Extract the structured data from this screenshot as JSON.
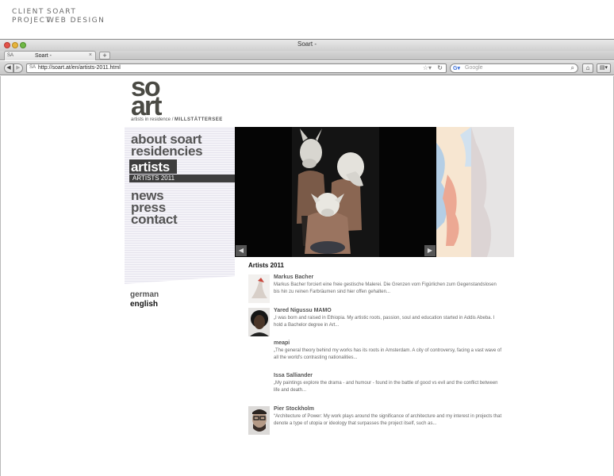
{
  "caption": {
    "client_label": "CLIENT",
    "client_value": "SOART",
    "project_label": "PROJECT",
    "project_value": "WEB DESIGN"
  },
  "browser": {
    "window_title": "Soart -",
    "tab_label": "Soart -",
    "new_tab": "+",
    "url": "http://soart.at/en/artists-2011.html",
    "search_placeholder": "Google"
  },
  "site": {
    "logo_line1": "so",
    "logo_line2": "art",
    "logo_tagline": "artists in residence /",
    "logo_location": "MILLSTÄTTERSEE",
    "nav": [
      {
        "label": "about soart"
      },
      {
        "label": "residencies"
      },
      {
        "label": "artists"
      },
      {
        "label": "news"
      },
      {
        "label": "press"
      },
      {
        "label": "contact"
      }
    ],
    "subnav_label": "ARTISTS 2011",
    "languages": [
      "german",
      "english"
    ],
    "section_title": "Artists 2011",
    "artists": [
      {
        "name": "Markus Bacher",
        "desc": "Markus Bacher forciert eine freie gestische Malerei. Die Grenzen vom Figürlichen zum Gegenstandslosen bis hin zu reinen Farbräumen sind hier offen gehalten..."
      },
      {
        "name": "Yared Nigussu MAMO",
        "desc": "„I was born and raised in Ethiopia. My artistic roots, passion, soul and education started in Addis Abeba. I hold a Bachelor degree in Art..."
      },
      {
        "name": "meapi",
        "desc": "„The general theory behind my works has its roots in Amsterdam. A city of controversy, facing a vast wave of all the world's contrasting nationalities..."
      },
      {
        "name": "Issa Salliander",
        "desc": "„My paintings explore the drama - and humour - found in the battle of good vs evil and the conflict between life and death..."
      },
      {
        "name": "Pier Stockholm",
        "desc": "“Architecture of Power: My work plays around the significance of architecture and my interest in projects that denote a type of utopia or ideology that surpasses the project itself, such as..."
      }
    ]
  },
  "colors": {
    "nav_text": "#555555",
    "nav_active_bg": "#3e3e3e",
    "logo": "#4a4a44"
  }
}
